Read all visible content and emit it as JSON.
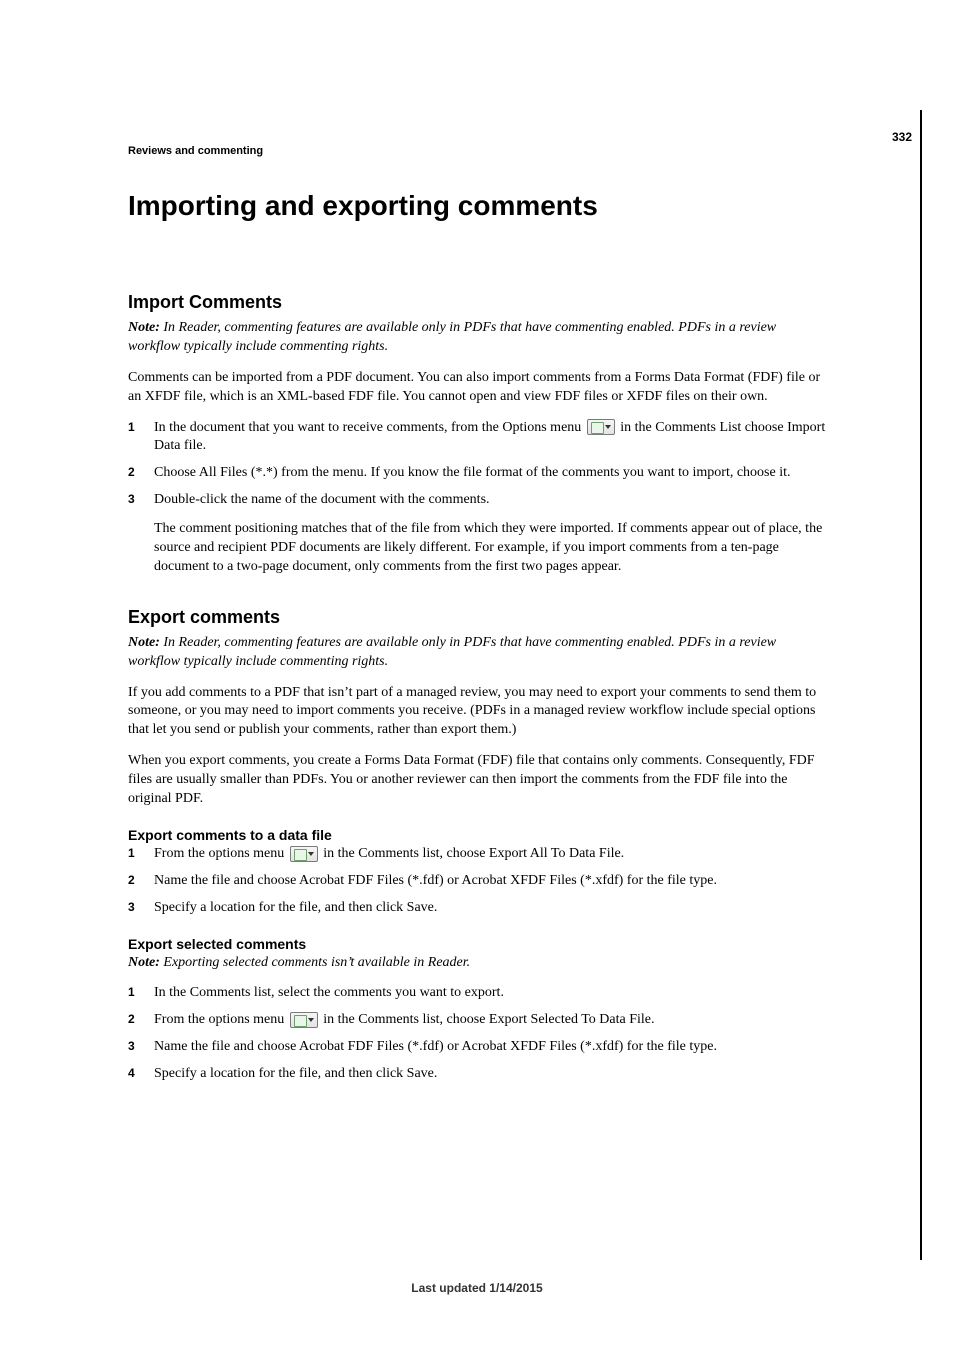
{
  "page_number": "332",
  "breadcrumb": "Reviews and commenting",
  "chapter_title": "Importing and exporting comments",
  "sections": {
    "import": {
      "heading": "Import Comments",
      "note_label": "Note:",
      "note_text": " In Reader, commenting features are available only in PDFs that have commenting enabled. PDFs in a review workflow typically include commenting rights.",
      "body1": "Comments can be imported from a PDF document. You can also import comments from a Forms Data Format (FDF) file or an XFDF file, which is an XML-based FDF file. You cannot open and view FDF files or XFDF files on their own.",
      "steps": [
        {
          "pre": "In the document that you want to receive comments, from the Options menu ",
          "post": " in the Comments List choose Import Data file."
        },
        {
          "text": "Choose All Files (*.*) from the menu. If you know the file format of the comments you want to import, choose it."
        },
        {
          "text": "Double-click the name of the document with the comments.",
          "extra": "The comment positioning matches that of the file from which they were imported. If comments appear out of place, the source and recipient PDF documents are likely different. For example, if you import comments from a ten-page document to a two-page document, only comments from the first two pages appear."
        }
      ]
    },
    "export": {
      "heading": "Export comments",
      "note_label": "Note:",
      "note_text": " In Reader, commenting features are available only in PDFs that have commenting enabled. PDFs in a review workflow typically include commenting rights.",
      "body1": "If you add comments to a PDF that isn’t part of a managed review, you may need to export your comments to send them to someone, or you may need to import comments you receive. (PDFs in a managed review workflow include special options that let you send or publish your comments, rather than export them.)",
      "body2": "When you export comments, you create a Forms Data Format (FDF) file that contains only comments. Consequently, FDF files are usually smaller than PDFs. You or another reviewer can then import the comments from the FDF file into the original PDF.",
      "sub1": {
        "heading": "Export comments to a data file",
        "steps": [
          {
            "pre": "From the options menu ",
            "post": " in the Comments list, choose Export All To Data File."
          },
          {
            "text": "Name the file and choose Acrobat FDF Files (*.fdf) or Acrobat XFDF Files (*.xfdf) for the file type."
          },
          {
            "text": "Specify a location for the file, and then click Save."
          }
        ]
      },
      "sub2": {
        "heading": "Export selected comments",
        "note_label": "Note:",
        "note_text": " Exporting selected comments isn’t available in Reader.",
        "steps": [
          {
            "text": "In the Comments list, select the comments you want to export."
          },
          {
            "pre": "From the options menu ",
            "post": " in the Comments list, choose Export Selected To Data File."
          },
          {
            "text": "Name the file and choose Acrobat FDF Files (*.fdf) or Acrobat XFDF Files (*.xfdf) for the file type."
          },
          {
            "text": "Specify a location for the file, and then click Save."
          }
        ]
      }
    }
  },
  "footer": "Last updated 1/14/2015",
  "icon_name": "options-menu-icon"
}
